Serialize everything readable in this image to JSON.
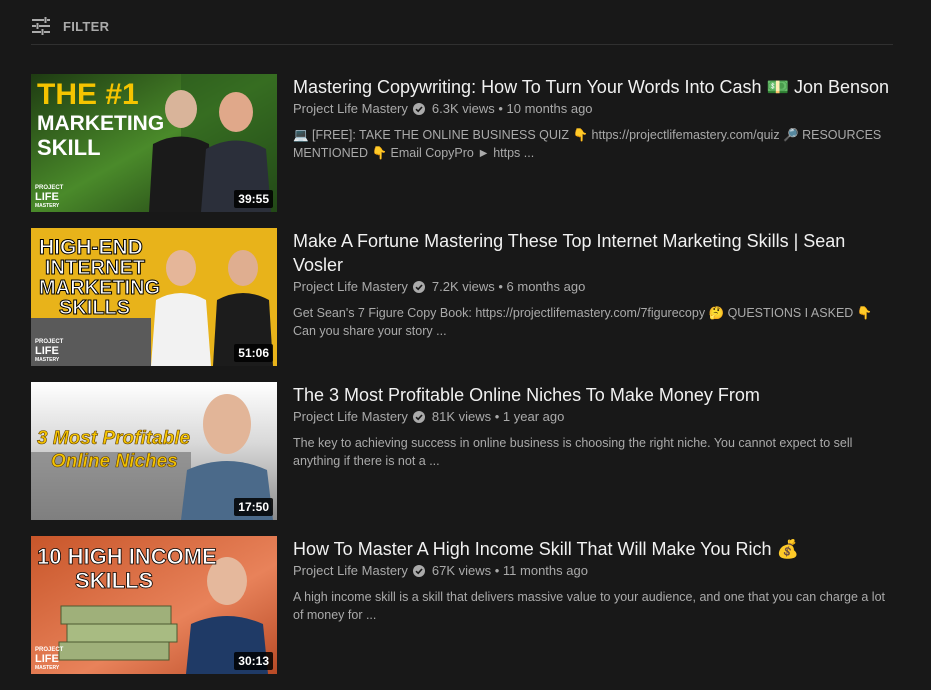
{
  "filter": {
    "icon": "filter-sliders-icon",
    "label": "FILTER"
  },
  "results": [
    {
      "title": "Mastering Copywriting: How To Turn Your Words Into Cash 💵 Jon Benson",
      "channel": "Project Life Mastery",
      "views": "6.3K views",
      "age": "10 months ago",
      "description": "💻 [FREE]: TAKE THE ONLINE BUSINESS QUIZ 👇 https://projectlifemastery.com/quiz 🔎 RESOURCES MENTIONED 👇 Email CopyPro ► https ...",
      "duration": "39:55",
      "thumb_text": [
        "THE #1",
        "MARKETING",
        "SKILL"
      ],
      "thumb_logo": [
        "PROJECT",
        "LIFE",
        "MASTERY"
      ]
    },
    {
      "title": "Make A Fortune Mastering These Top Internet Marketing Skills | Sean Vosler",
      "channel": "Project Life Mastery",
      "views": "7.2K views",
      "age": "6 months ago",
      "description": "Get Sean's 7 Figure Copy Book: https://projectlifemastery.com/7figurecopy 🤔 QUESTIONS I ASKED 👇 Can you share your story ...",
      "duration": "51:06",
      "thumb_text": [
        "HIGH-END",
        "INTERNET",
        "MARKETING",
        "SKILLS"
      ],
      "thumb_logo": [
        "PROJECT",
        "LIFE",
        "MASTERY"
      ]
    },
    {
      "title": "The 3 Most Profitable Online Niches To Make Money From",
      "channel": "Project Life Mastery",
      "views": "81K views",
      "age": "1 year ago",
      "description": "The key to achieving success in online business is choosing the right niche. You cannot expect to sell anything if there is not a ...",
      "duration": "17:50",
      "thumb_text": [
        "3 Most Profitable",
        "Online Niches"
      ],
      "thumb_logo": []
    },
    {
      "title": "How To Master A High Income Skill That Will Make You Rich 💰",
      "channel": "Project Life Mastery",
      "views": "67K views",
      "age": "11 months ago",
      "description": "A high income skill is a skill that delivers massive value to your audience, and one that you can charge a lot of money for ...",
      "duration": "30:13",
      "thumb_text": [
        "10 HIGH INCOME",
        "SKILLS"
      ],
      "thumb_logo": [
        "PROJECT",
        "LIFE",
        "MASTERY"
      ]
    }
  ],
  "colors": {
    "background": "#181818",
    "title": "#f1f1f1",
    "meta": "#aaaaaa",
    "accent_green": "#6ab04c"
  }
}
